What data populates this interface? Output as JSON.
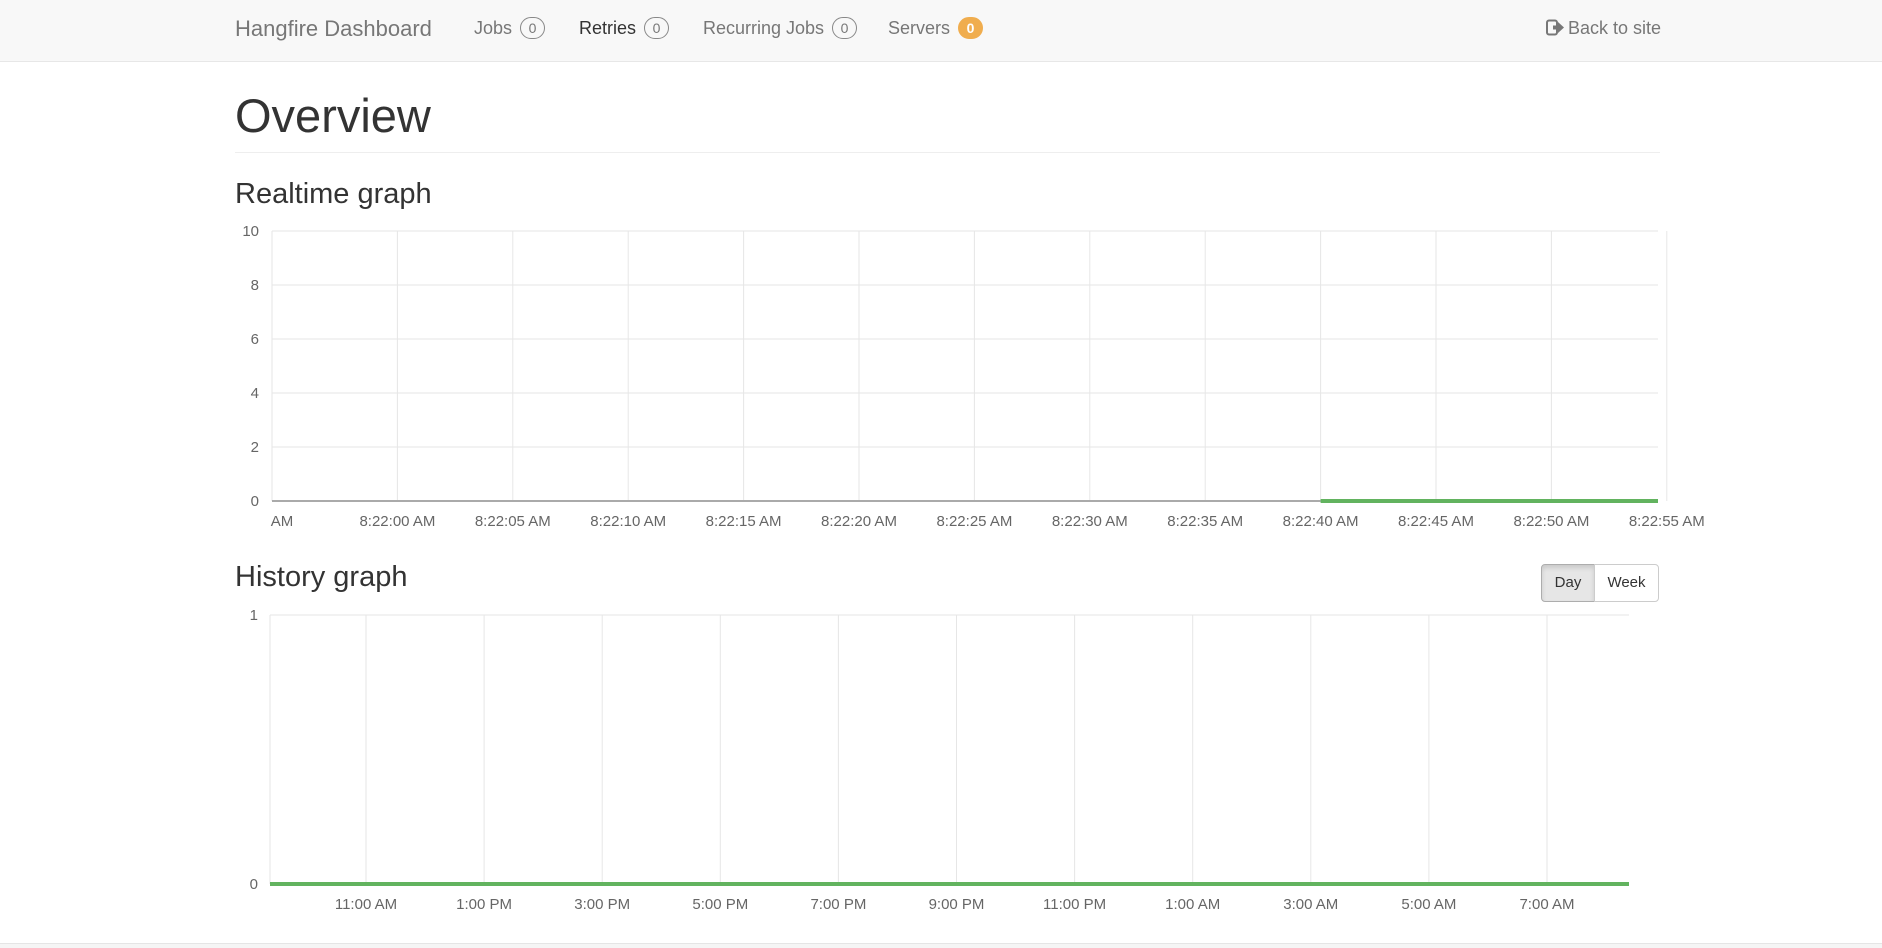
{
  "navbar": {
    "brand": "Hangfire Dashboard",
    "items": [
      {
        "label": "Jobs",
        "count": "0"
      },
      {
        "label": "Retries",
        "count": "0"
      },
      {
        "label": "Recurring Jobs",
        "count": "0"
      },
      {
        "label": "Servers",
        "count": "0"
      }
    ],
    "back_link": "Back to site"
  },
  "page": {
    "title": "Overview",
    "realtime_title": "Realtime graph",
    "history_title": "History graph",
    "history_range": {
      "day_label": "Day",
      "week_label": "Week",
      "selected": "Day"
    }
  },
  "colors": {
    "succeeded": "#62b35f",
    "failed": "#d9534f",
    "warning_badge": "#f0ad4e"
  },
  "chart_data": [
    {
      "type": "line",
      "name": "realtime",
      "ylim": [
        0,
        10
      ],
      "yticks": [
        "10",
        "8",
        "6",
        "4",
        "2",
        "0"
      ],
      "xticks": [
        "AM",
        "8:22:00 AM",
        "8:22:05 AM",
        "8:22:10 AM",
        "8:22:15 AM",
        "8:22:20 AM",
        "8:22:25 AM",
        "8:22:30 AM",
        "8:22:35 AM",
        "8:22:40 AM",
        "8:22:45 AM",
        "8:22:50 AM",
        "8:22:55 AM"
      ],
      "series": [
        {
          "color": "#62b35f",
          "x": [
            "8:22:40 AM",
            "8:22:45 AM",
            "8:22:50 AM",
            "8:22:55 AM"
          ],
          "values": [
            0,
            0,
            0,
            0
          ]
        },
        {
          "color": "#aaaaaa",
          "x": [
            "AM",
            "8:22:00 AM",
            "8:22:05 AM",
            "8:22:10 AM",
            "8:22:15 AM",
            "8:22:20 AM",
            "8:22:25 AM",
            "8:22:30 AM",
            "8:22:35 AM",
            "8:22:40 AM"
          ],
          "values": [
            0,
            0,
            0,
            0,
            0,
            0,
            0,
            0,
            0,
            0
          ]
        }
      ],
      "grid": true
    },
    {
      "type": "line",
      "name": "history",
      "ylim": [
        0,
        1
      ],
      "yticks": [
        "1",
        "0"
      ],
      "xticks": [
        "11:00 AM",
        "1:00 PM",
        "3:00 PM",
        "5:00 PM",
        "7:00 PM",
        "9:00 PM",
        "11:00 PM",
        "1:00 AM",
        "3:00 AM",
        "5:00 AM",
        "7:00 AM"
      ],
      "series": [
        {
          "color": "#62b35f",
          "values": [
            0,
            0,
            0,
            0,
            0,
            0,
            0,
            0,
            0,
            0,
            0,
            0,
            0
          ]
        }
      ],
      "grid": true
    }
  ]
}
